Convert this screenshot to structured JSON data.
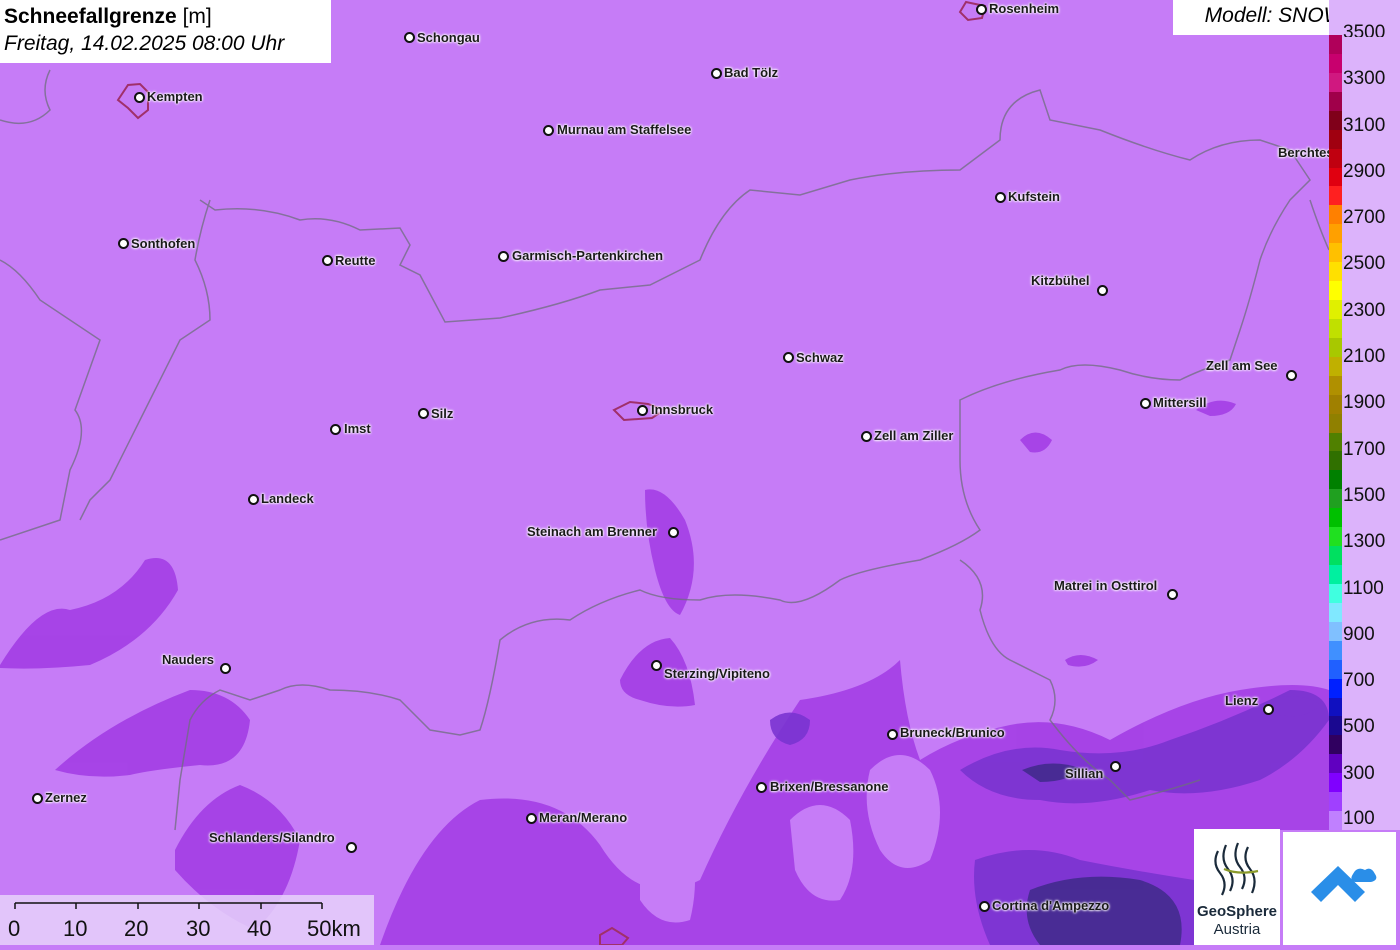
{
  "title": {
    "main": "Schneefallgrenze",
    "unit": "[m]",
    "datetime": "Freitag, 14.02.2025 08:00 Uhr"
  },
  "model": {
    "label": "Modell: SNOWGRID"
  },
  "cities": [
    {
      "name": "Rosenheim"
    },
    {
      "name": "Schongau"
    },
    {
      "name": "Bad Tölz"
    },
    {
      "name": "Kempten"
    },
    {
      "name": "Murnau am Staffelsee"
    },
    {
      "name": "Berchtesgaden"
    },
    {
      "name": "Kufstein"
    },
    {
      "name": "Sonthofen"
    },
    {
      "name": "Reutte"
    },
    {
      "name": "Garmisch-Partenkirchen"
    },
    {
      "name": "Kitzbühel"
    },
    {
      "name": "Schwaz"
    },
    {
      "name": "Zell am See"
    },
    {
      "name": "Mittersill"
    },
    {
      "name": "Imst"
    },
    {
      "name": "Silz"
    },
    {
      "name": "Innsbruck"
    },
    {
      "name": "Zell am Ziller"
    },
    {
      "name": "Landeck"
    },
    {
      "name": "Steinach am Brenner"
    },
    {
      "name": "Matrei in Osttirol"
    },
    {
      "name": "Nauders"
    },
    {
      "name": "Sterzing/Vipiteno"
    },
    {
      "name": "Lienz"
    },
    {
      "name": "Bruneck/Brunico"
    },
    {
      "name": "Sillian"
    },
    {
      "name": "Brixen/Bressanone"
    },
    {
      "name": "Zernez"
    },
    {
      "name": "Meran/Merano"
    },
    {
      "name": "Schlanders/Silandro"
    },
    {
      "name": "Cortina d'Ampezzo"
    }
  ],
  "legend": {
    "labels": [
      "3500",
      "3300",
      "3100",
      "2900",
      "2700",
      "2500",
      "2300",
      "2100",
      "1900",
      "1700",
      "1500",
      "1300",
      "1100",
      "900",
      "700",
      "500",
      "300",
      "100"
    ],
    "colors": [
      "#b0005a",
      "#c8006e",
      "#d01880",
      "#a0004a",
      "#80001a",
      "#a00010",
      "#c00010",
      "#e00010",
      "#ff2020",
      "#ff8000",
      "#ffa000",
      "#ffc000",
      "#ffe000",
      "#ffff00",
      "#e0f000",
      "#c0e000",
      "#a8c800",
      "#c0b000",
      "#b09000",
      "#a08000",
      "#908000",
      "#508000",
      "#307000",
      "#008000",
      "#20a020",
      "#00c000",
      "#20e020",
      "#00e060",
      "#00f0a0",
      "#40ffe0",
      "#80e8ff",
      "#80c0ff",
      "#4090ff",
      "#2060ff",
      "#0020ff",
      "#1010c0",
      "#1a0890",
      "#300060",
      "#6000c0",
      "#8000ff",
      "#a040ff",
      "#c080ff"
    ]
  },
  "scale": {
    "labels": [
      "0",
      "10",
      "20",
      "30",
      "40",
      "50km"
    ]
  },
  "logo": {
    "line1": "GeoSphere",
    "line2": "Austria"
  },
  "colors": {
    "base": "#c67cf7",
    "low": "#9b2fdc",
    "lower": "#6a28c8",
    "lowest": "#3a1a70"
  }
}
